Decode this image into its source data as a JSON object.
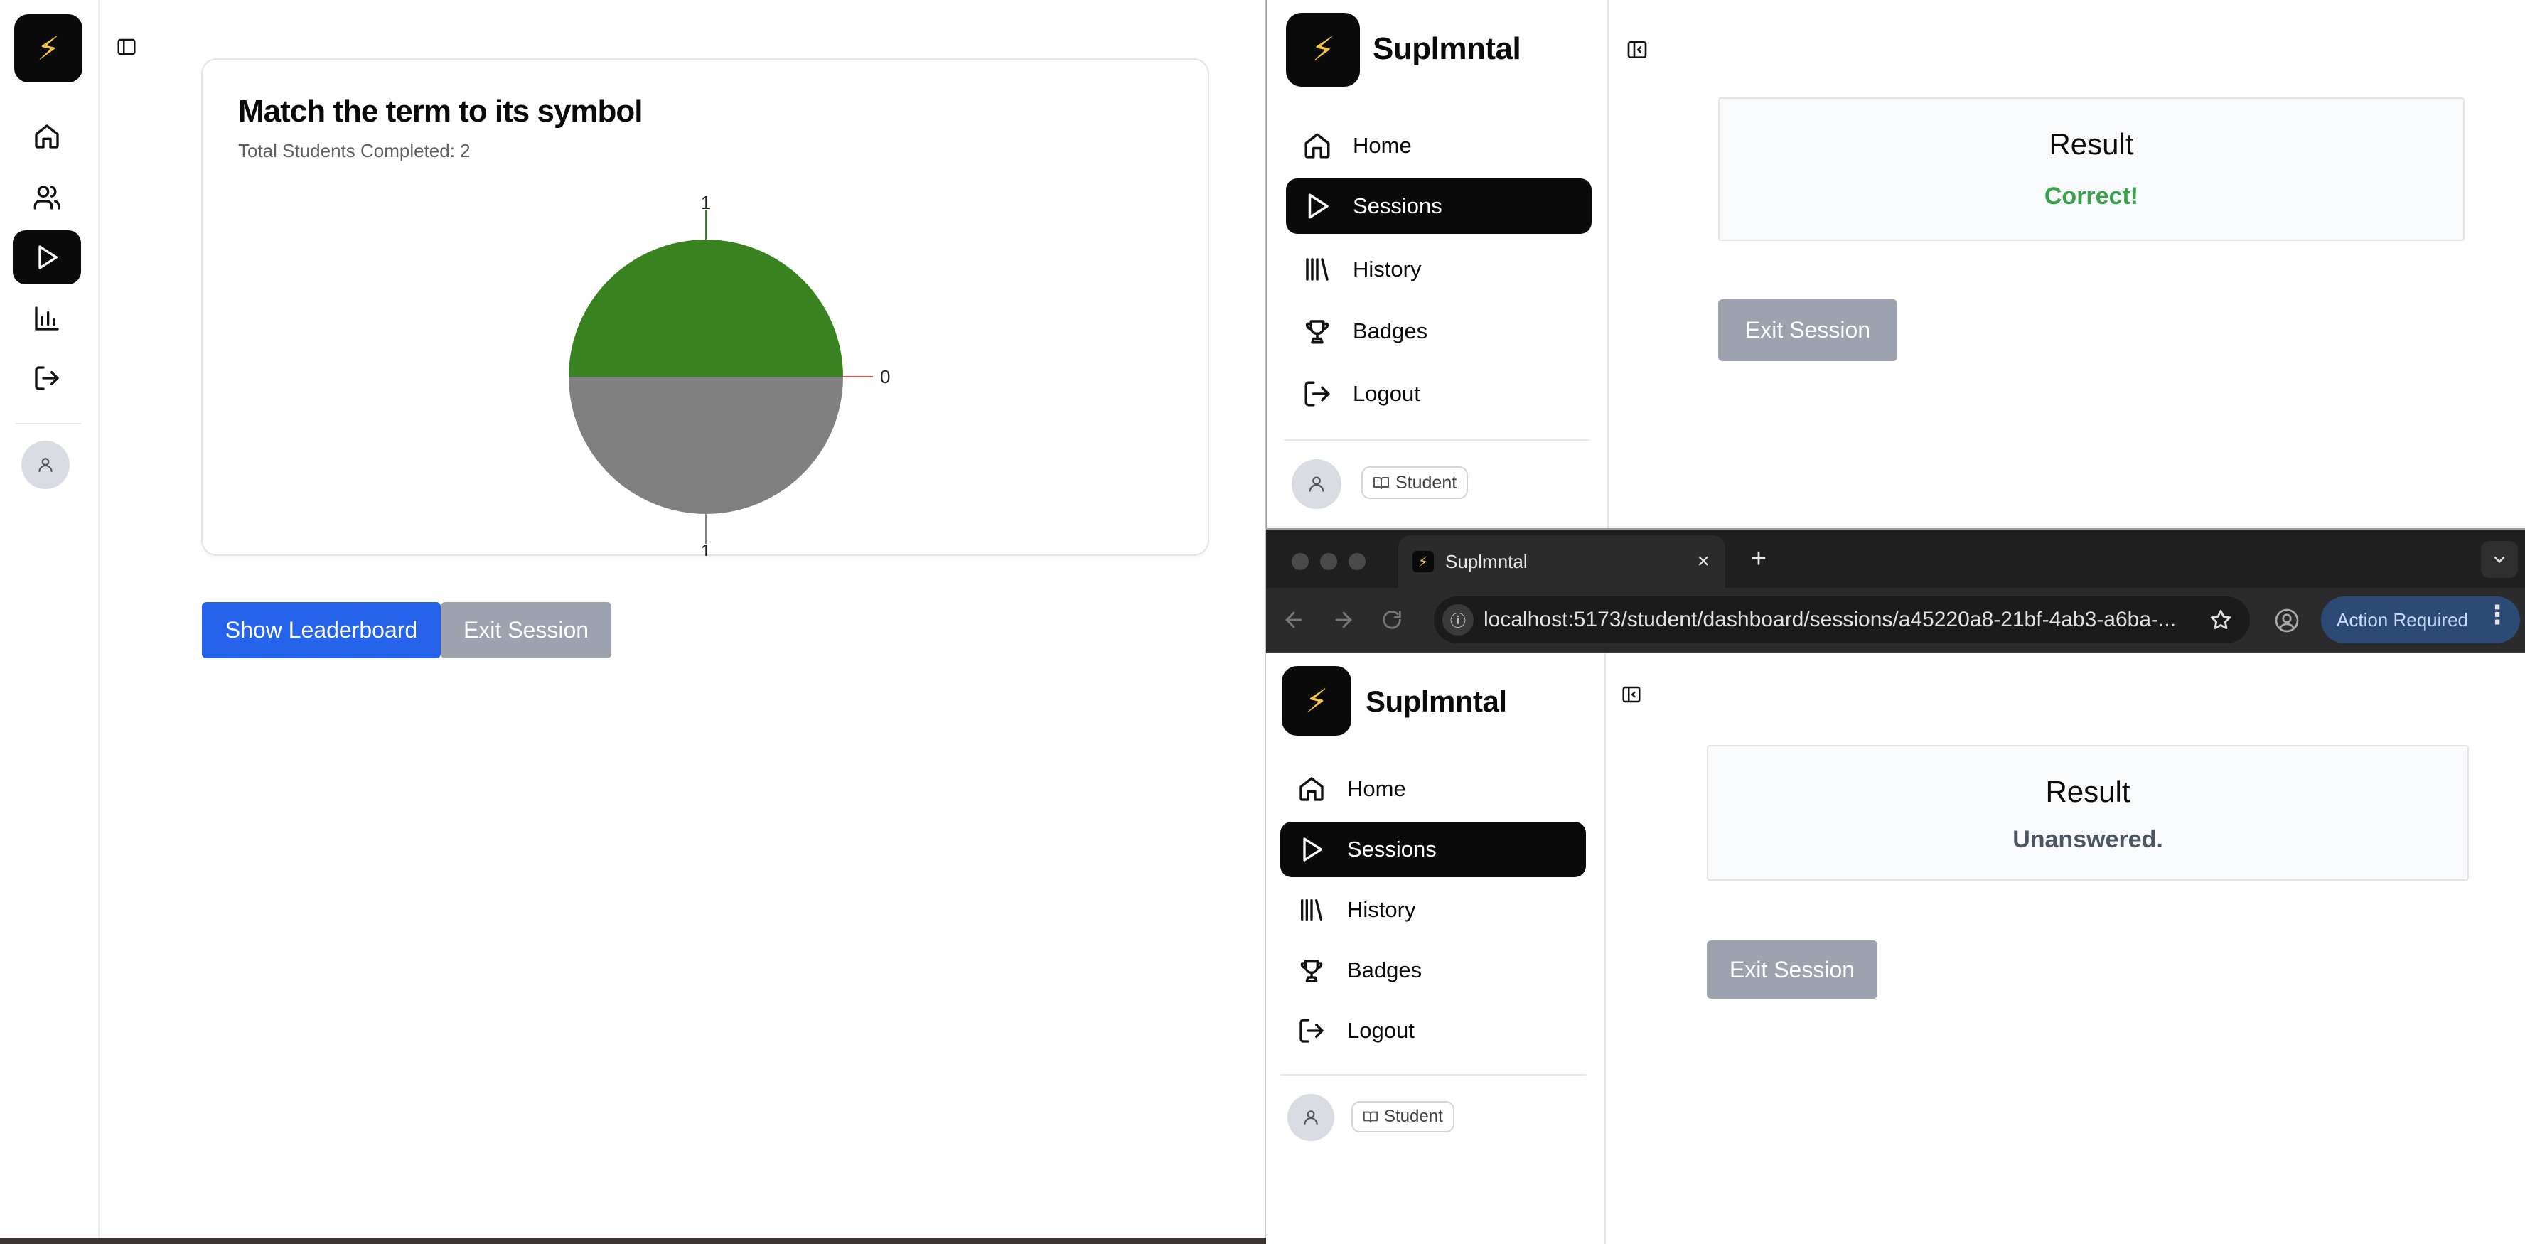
{
  "left_window": {
    "card": {
      "title": "Match the term to its symbol",
      "subtitle": "Total Students Completed: 2"
    },
    "buttons": {
      "leaderboard": "Show Leaderboard",
      "exit": "Exit Session"
    }
  },
  "chart_data": {
    "type": "pie",
    "slices": [
      {
        "label": "1",
        "value": 1,
        "color": "#38821f"
      },
      {
        "label": "0",
        "value": 0,
        "color": "#d9534f"
      },
      {
        "label": "1",
        "value": 1,
        "color": "#808080"
      }
    ]
  },
  "app": {
    "logo_glyph": "⚡",
    "name": "Suplmntal",
    "nav": [
      {
        "label": "Home",
        "icon": "home-icon"
      },
      {
        "label": "Sessions",
        "icon": "play-icon"
      },
      {
        "label": "History",
        "icon": "library-icon"
      },
      {
        "label": "Badges",
        "icon": "trophy-icon"
      },
      {
        "label": "Logout",
        "icon": "logout-icon"
      }
    ],
    "role": "Student",
    "result_title": "Result",
    "exit_label": "Exit Session"
  },
  "top_right": {
    "result_value": "Correct!",
    "result_color": "#3aa14a"
  },
  "bottom_right": {
    "result_value": "Unanswered.",
    "result_color": "#4b5563",
    "browser": {
      "tab_title": "Suplmntal",
      "url": "localhost:5173/student/dashboard/sessions/a45220a8-21bf-4ab3-a6ba-...",
      "action_label": "Action Required"
    }
  },
  "colors": {
    "accent": "#2563eb",
    "active_nav": "#0a0a0a",
    "pie_green": "#38821f",
    "pie_gray": "#808080"
  }
}
